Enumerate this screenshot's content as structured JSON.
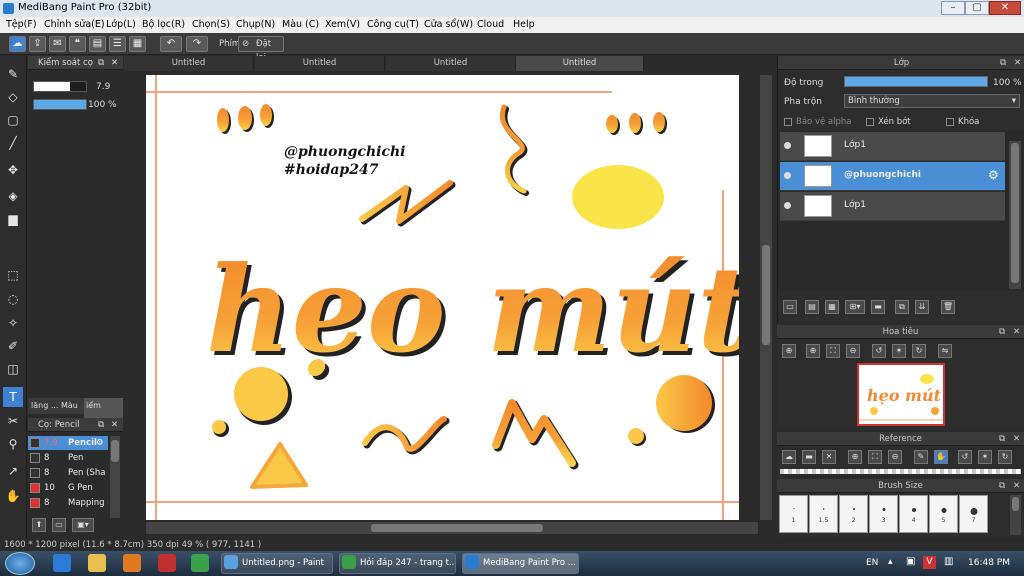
{
  "window": {
    "title": "MediBang Paint Pro (32bit)",
    "min": "–",
    "max": "▢",
    "close": "✕"
  },
  "menu": [
    "Tệp(F)",
    "Chỉnh sửa(E)",
    "Lớp(L)",
    "Bộ lọc(R)",
    "Chọn(S)",
    "Chụp(N)",
    "Màu (C)",
    "Xem(V)",
    "Công cụ(T)",
    "Cửa sổ(W)",
    "Cloud",
    "Help"
  ],
  "toolbar": {
    "phim_label": "Phím",
    "reset_label": "Đặt lại"
  },
  "brush_control": {
    "title": "Kiểm soát cọ",
    "size_value": "7.9",
    "opacity_value": "100 %",
    "size_fraction": 0.7,
    "opacity_fraction": 1.0,
    "tabs": [
      "lăng ...",
      "Màu",
      "iểm soát."
    ]
  },
  "brush_list": {
    "title": "Cọ: Pencil",
    "items": [
      {
        "size": "7.9",
        "name": "Pencil",
        "color": "#333333",
        "selected": true
      },
      {
        "size": "8",
        "name": "Pen",
        "color": "#333333",
        "selected": false
      },
      {
        "size": "8",
        "name": "Pen (Sha",
        "color": "#333333",
        "selected": false
      },
      {
        "size": "10",
        "name": "G Pen",
        "color": "#e03030",
        "selected": false
      },
      {
        "size": "8",
        "name": "Mapping P",
        "color": "#e03030",
        "selected": false
      }
    ]
  },
  "canvas": {
    "tabs": [
      "Untitled",
      "Untitled",
      "Untitled",
      "Untitled"
    ],
    "active_tab": 3,
    "artwork": {
      "handle_line1": "@phuongchichi",
      "handle_line2": "#hoidap247",
      "headline": "hẹo mút",
      "colors": {
        "orange": "#f28b30",
        "yellow": "#f9e44a",
        "frame": "#f3a27e"
      }
    }
  },
  "layer_panel": {
    "title": "Lớp",
    "opacity_label": "Độ trong",
    "opacity_value": "100 %",
    "blend_label": "Pha trộn",
    "blend_value": "Bình thường",
    "protect_alpha": "Bảo vệ alpha",
    "clip": "Xén bớt",
    "lock": "Khóa",
    "layers": [
      {
        "name": "Lớp1",
        "selected": false
      },
      {
        "name": "@phuongchichi",
        "selected": true
      },
      {
        "name": "Lớp1",
        "selected": false
      }
    ]
  },
  "navigator": {
    "title": "Hoa tiêu"
  },
  "reference": {
    "title": "Reference"
  },
  "brush_size": {
    "title": "Brush Size",
    "sizes": [
      "1",
      "1.5",
      "2",
      "3",
      "4",
      "5",
      "7"
    ]
  },
  "status": {
    "text": "1600 * 1200 pixel  (11.6 * 8.7cm)  350 dpi  49 %  ( 977, 1141 )"
  },
  "taskbar": {
    "apps": [
      "Untitled.png - Paint",
      "Hỏi đáp 247 - trang t...",
      "MediBang Paint Pro ..."
    ],
    "lang": "EN",
    "time": "16:48 PM"
  }
}
